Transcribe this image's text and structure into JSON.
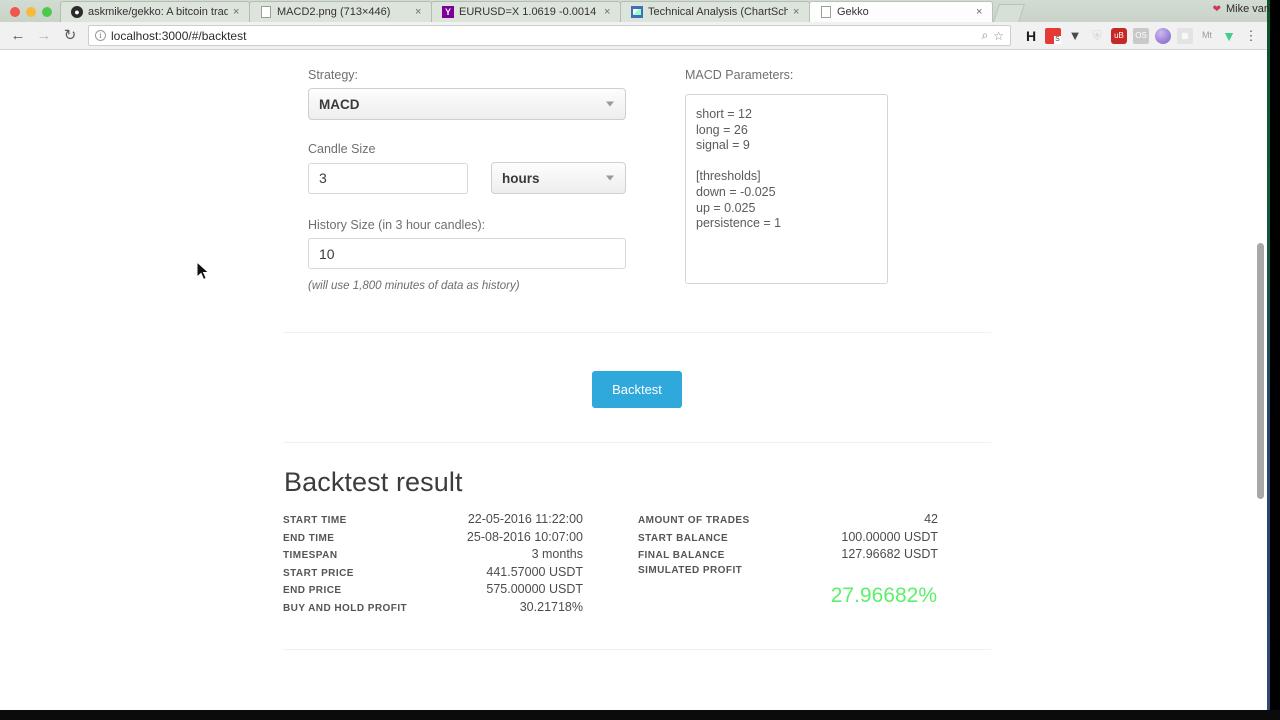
{
  "os": {
    "menubar_user": "Mike van",
    "menubar_icon": "heart-icon"
  },
  "browser": {
    "tabs": [
      {
        "title": "askmike/gekko: A bitcoin trad",
        "favicon": "github-icon",
        "active": false,
        "close": "×"
      },
      {
        "title": "MACD2.png (713×446)",
        "favicon": "document-icon",
        "active": false,
        "close": "×"
      },
      {
        "title": "EURUSD=X 1.0619 -0.0014",
        "favicon": "yahoo-icon",
        "active": false,
        "close": "×"
      },
      {
        "title": "Technical Analysis (ChartScho",
        "favicon": "chart-icon",
        "active": false,
        "close": "×"
      },
      {
        "title": "Gekko",
        "favicon": "document-icon",
        "active": true,
        "close": "×"
      }
    ],
    "nav": {
      "back": "←",
      "forward": "→",
      "reload": "↻"
    },
    "omnibox": {
      "info_icon": "i",
      "url": "localhost:3000/#/backtest",
      "zoom_icon": "⌕",
      "bookmark_icon": "☆"
    },
    "extensions": [
      {
        "name": "honey-extension",
        "glyph": "H"
      },
      {
        "name": "red-s-extension",
        "glyph": ""
      },
      {
        "name": "pocket-extension",
        "glyph": "▼"
      },
      {
        "name": "ghost-extension",
        "glyph": "⛨"
      },
      {
        "name": "ublock-extension",
        "glyph": "uB"
      },
      {
        "name": "os-extension",
        "glyph": "OS"
      },
      {
        "name": "globe-extension",
        "glyph": ""
      },
      {
        "name": "qr-extension",
        "glyph": "▦"
      },
      {
        "name": "mt-extension",
        "glyph": "Mt"
      },
      {
        "name": "vue-devtools-extension",
        "glyph": "▼"
      },
      {
        "name": "chrome-menu",
        "glyph": "⋮"
      }
    ]
  },
  "form": {
    "strategy_label": "Strategy:",
    "strategy_value": "MACD",
    "strategy_options": [
      "MACD"
    ],
    "candle_label": "Candle Size",
    "candle_value": "3",
    "candle_unit": "hours",
    "candle_unit_options": [
      "hours"
    ],
    "history_label": "History Size (in 3 hour candles):",
    "history_value": "10",
    "history_hint": "(will use 1,800 minutes of data as history)",
    "params_label": "MACD Parameters:",
    "params_value": "short = 12\nlong = 26\nsignal = 9\n\n[thresholds]\ndown = -0.025\nup = 0.025\npersistence = 1",
    "backtest_button": "Backtest"
  },
  "results": {
    "title": "Backtest result",
    "accent_profit_color": "#5bf06b",
    "left": [
      {
        "key": "START TIME",
        "value": "22-05-2016 11:22:00"
      },
      {
        "key": "END TIME",
        "value": "25-08-2016 10:07:00"
      },
      {
        "key": "TIMESPAN",
        "value": "3 months"
      },
      {
        "key": "START PRICE",
        "value": "441.57000 USDT"
      },
      {
        "key": "END PRICE",
        "value": "575.00000 USDT"
      },
      {
        "key": "BUY AND HOLD PROFIT",
        "value": "30.21718%"
      }
    ],
    "right": [
      {
        "key": "AMOUNT OF TRADES",
        "value": "42"
      },
      {
        "key": "START BALANCE",
        "value": "100.00000 USDT"
      },
      {
        "key": "FINAL BALANCE",
        "value": "127.96682 USDT"
      },
      {
        "key": "SIMULATED PROFIT",
        "value": ""
      }
    ],
    "simulated_profit": "27.96682%"
  }
}
